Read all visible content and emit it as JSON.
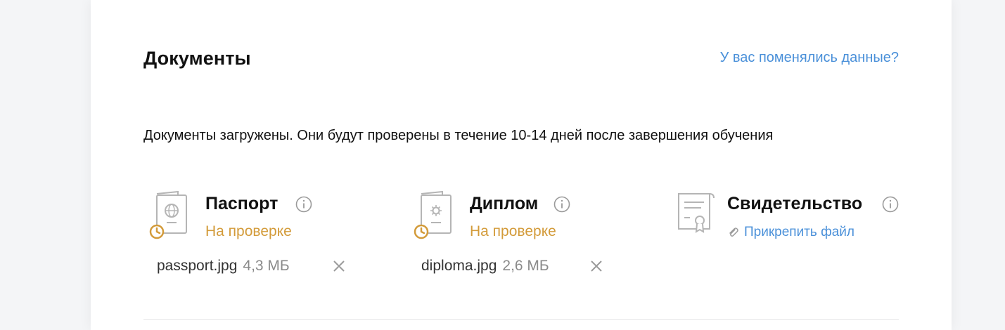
{
  "section": {
    "title": "Документы",
    "changed_link": "У вас поменялись данные?",
    "info": "Документы загружены. Они будут проверены в течение 10-14 дней после завершения обучения"
  },
  "documents": [
    {
      "title": "Паспорт",
      "status": "На проверке",
      "file_name": "passport.jpg",
      "file_size": "4,3 МБ",
      "icon": "passport-icon"
    },
    {
      "title": "Диплом",
      "status": "На проверке",
      "file_name": "diploma.jpg",
      "file_size": "2,6 МБ",
      "icon": "diploma-icon"
    },
    {
      "title": "Свидетельство",
      "attach_label": "Прикрепить файл",
      "icon": "certificate-icon"
    }
  ],
  "colors": {
    "link": "#4a90d9",
    "status_pending": "#d39b3a",
    "icon_gray": "#b5b5b5"
  }
}
